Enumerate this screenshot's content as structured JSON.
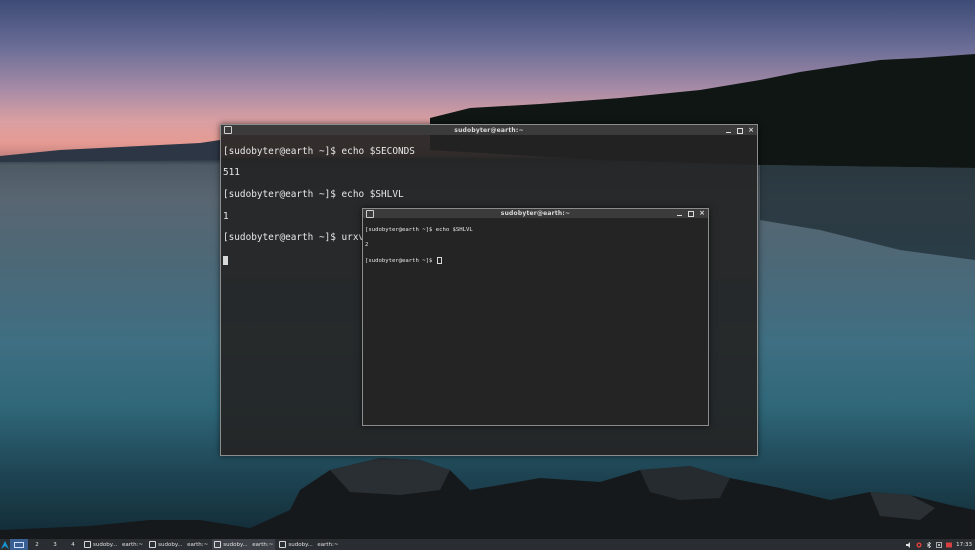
{
  "terminal_main": {
    "title": "sudobyter@earth:~",
    "lines": [
      "[sudobyter@earth ~]$ echo $SECONDS",
      "511",
      "[sudobyter@earth ~]$ echo $SHLVL",
      "1",
      "[sudobyter@earth ~]$ urxvt"
    ]
  },
  "terminal_child": {
    "title": "sudobyter@earth:~",
    "lines": [
      "[sudobyter@earth ~]$ echo $SHLVL",
      "2",
      "[sudobyter@earth ~]$ "
    ]
  },
  "window_controls": {
    "close": "×"
  },
  "taskbar": {
    "menu_icon": "arch-logo-icon",
    "workspaces": [
      "",
      "2",
      "3",
      "4"
    ],
    "tasks": [
      {
        "main": "sudoby...",
        "secondary": "earth:~"
      },
      {
        "main": "sudoby...",
        "secondary": "earth:~"
      },
      {
        "main": "sudoby...",
        "secondary": "earth:~"
      },
      {
        "main": "sudoby...",
        "secondary": "earth:~"
      }
    ],
    "tray_icons": [
      "volume-icon",
      "network-icon",
      "bluetooth-icon",
      "screenshot-icon",
      "notification-icon"
    ],
    "clock": "17:33"
  },
  "colors": {
    "terminal_bg": "#242424",
    "terminal_text": "#e8e8e8",
    "taskbar_bg": "#2a2d31",
    "workspace_active": "#3a5f93"
  }
}
